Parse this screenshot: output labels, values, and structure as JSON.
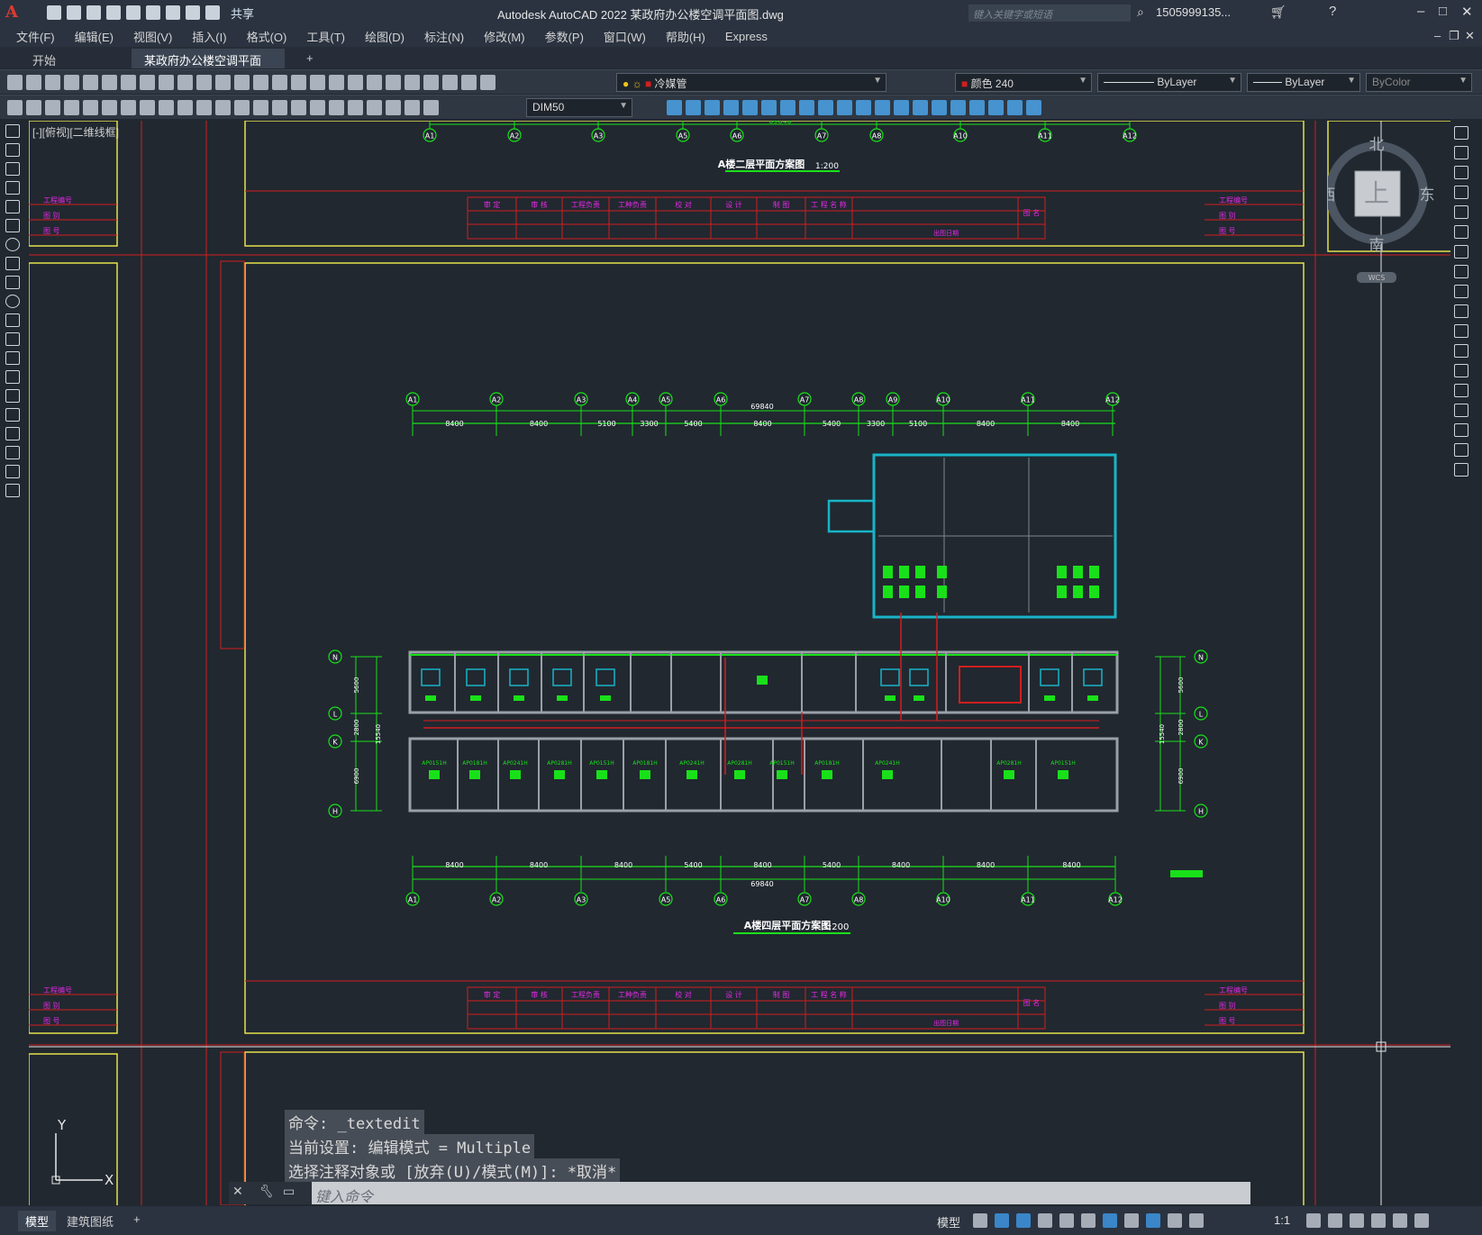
{
  "app": {
    "title": "Autodesk AutoCAD 2022    某政府办公楼空调平面图.dwg",
    "share_label": "共享",
    "search_placeholder": "键入关键字或短语",
    "user": "1505999135...",
    "logo": "A"
  },
  "menu": [
    "文件(F)",
    "编辑(E)",
    "视图(V)",
    "插入(I)",
    "格式(O)",
    "工具(T)",
    "绘图(D)",
    "标注(N)",
    "修改(M)",
    "参数(P)",
    "窗口(W)",
    "帮助(H)",
    "Express"
  ],
  "tabs": {
    "start": "开始",
    "doc": "某政府办公楼空调平面图*",
    "close": "✕",
    "add": "+"
  },
  "toolbar": {
    "layer": "冷媒管",
    "color": "颜色 240",
    "linetype": "ByLayer",
    "lineweight": "ByLayer",
    "plotstyle": "ByColor",
    "dimstyle": "DIM50"
  },
  "colors": {
    "cad_yellow": "#e6e14b",
    "cad_red": "#d21e1e",
    "cad_green": "#19e119",
    "cad_cyan": "#19b4c8",
    "cad_magenta": "#e628e6",
    "background": "#212830"
  },
  "viewport_label": "[-][俯视][二维线框]",
  "viewcube": {
    "north": "北",
    "south": "南",
    "east": "东",
    "west": "西",
    "top": "上",
    "wcs": "WCS"
  },
  "drawing": {
    "top_dim_total": "69840",
    "title_upper": "A楼二层平面方案图",
    "scale_upper": "1:200",
    "title_lower": "A楼四层平面方案图",
    "scale_lower": "1:200",
    "axes_top": [
      "A1",
      "A2",
      "A3",
      "A4",
      "A5",
      "A6",
      "A7",
      "A8",
      "A9",
      "A10",
      "A11",
      "A12"
    ],
    "dims_top": [
      "8400",
      "8400",
      "5100",
      "3300",
      "5400",
      "8400",
      "5400",
      "3300",
      "5100",
      "8400",
      "8400"
    ],
    "axes_top_upper": [
      "A1",
      "A2",
      "A3",
      "A5",
      "A6",
      "A7",
      "A8",
      "A10",
      "A11",
      "A12"
    ],
    "axes_bottom": [
      "A1",
      "A2",
      "A3",
      "A5",
      "A6",
      "A7",
      "A8",
      "A10",
      "A11",
      "A12"
    ],
    "dims_bottom": [
      "8400",
      "8400",
      "8400",
      "5400",
      "8400",
      "5400",
      "8400",
      "8400",
      "8400"
    ],
    "bottom_total": "69840",
    "rows": [
      "N",
      "L",
      "K",
      "H"
    ],
    "row_dims": [
      "5600",
      "2800",
      "6900"
    ],
    "row_total": "15540",
    "titleblock": [
      "审 定",
      "审 核",
      "工程负责",
      "工种负责",
      "校 对",
      "设 计",
      "制 图",
      "工 程 名 称"
    ],
    "titleblock_side": [
      "工程编号",
      "图 别",
      "图 号"
    ],
    "titleblock_label": "图 名",
    "stamp": "出图日期",
    "units": [
      "AP0151H",
      "AP0181H",
      "AP0241H",
      "AP0281H"
    ]
  },
  "command": {
    "line1": "命令: _textedit",
    "line2": "当前设置: 编辑模式 = Multiple",
    "line3": "选择注释对象或 [放弃(U)/模式(M)]: *取消*",
    "placeholder": "键入命令"
  },
  "status": {
    "model_tab": "模型",
    "layout_tab": "建筑图纸",
    "add": "+",
    "mode": "模型",
    "scale": "1:1"
  }
}
